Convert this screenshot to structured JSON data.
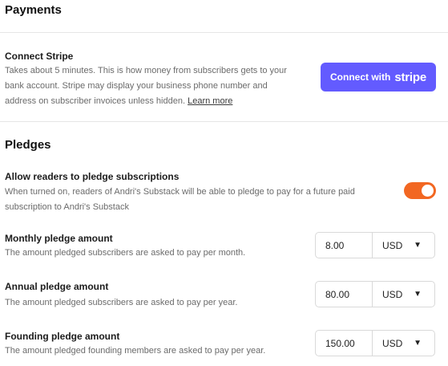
{
  "payments": {
    "title": "Payments",
    "connect_stripe": {
      "title": "Connect Stripe",
      "desc_line1": "Takes about 5 minutes. This is how money from subscribers gets to your",
      "desc_line2": "bank account. Stripe may display your business phone number and",
      "desc_line3": "address on subscriber invoices unless hidden.",
      "learn_more": "Learn more",
      "button_text": "Connect with",
      "button_wordmark": "stripe",
      "button_color": "#635bff"
    }
  },
  "pledges": {
    "title": "Pledges",
    "allow": {
      "title": "Allow readers to pledge subscriptions",
      "desc_line1": "When turned on, readers of Andri's Substack will be able to pledge to pay for a future paid",
      "desc_line2": "subscription to Andri's Substack",
      "toggle_on": true,
      "toggle_color": "#f26722"
    },
    "monthly": {
      "title": "Monthly pledge amount",
      "desc": "The amount pledged subscribers are asked to pay per month.",
      "amount": "8.00",
      "currency": "USD"
    },
    "annual": {
      "title": "Annual pledge amount",
      "desc": "The amount pledged subscribers are asked to pay per year.",
      "amount": "80.00",
      "currency": "USD"
    },
    "founding": {
      "title": "Founding pledge amount",
      "desc": "The amount pledged founding members are asked to pay per year.",
      "amount": "150.00",
      "currency": "USD"
    }
  },
  "icons": {
    "dropdown": "caret-down-icon"
  }
}
